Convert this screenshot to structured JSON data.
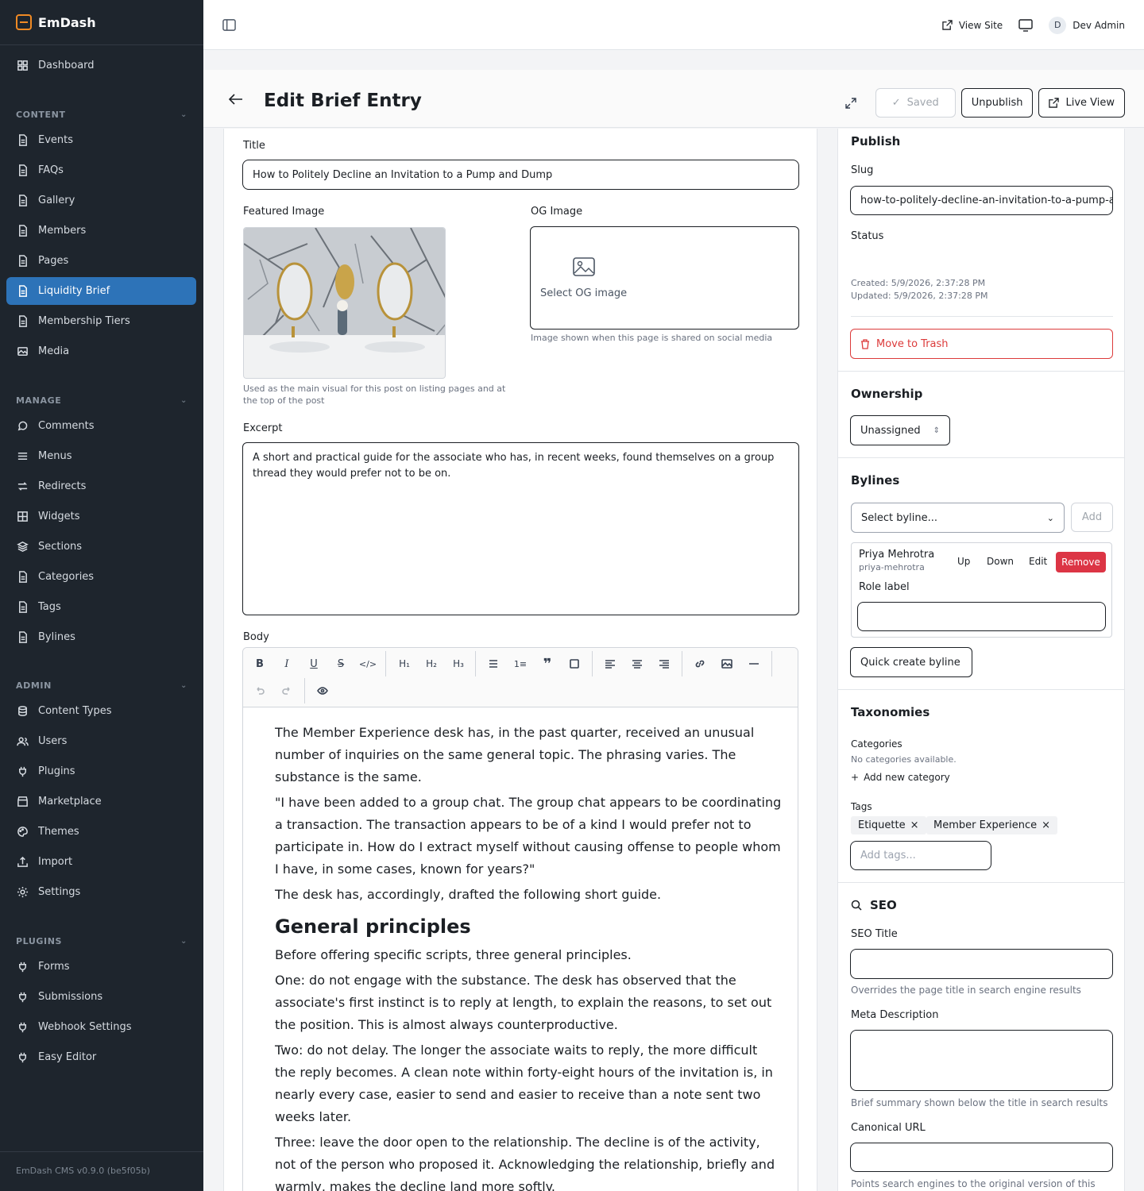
{
  "app": {
    "name": "EmDash",
    "version": "EmDash CMS v0.9.0 (be5f05b)"
  },
  "sidebar": {
    "dashboard": "Dashboard",
    "sections": {
      "content": "CONTENT",
      "manage": "MANAGE",
      "admin": "ADMIN",
      "plugins": "PLUGINS"
    },
    "content_items": [
      "Events",
      "FAQs",
      "Gallery",
      "Members",
      "Pages",
      "Liquidity Brief",
      "Membership Tiers",
      "Media"
    ],
    "manage_items": [
      "Comments",
      "Menus",
      "Redirects",
      "Widgets",
      "Sections",
      "Categories",
      "Tags",
      "Bylines"
    ],
    "admin_items": [
      "Content Types",
      "Users",
      "Plugins",
      "Marketplace",
      "Themes",
      "Import",
      "Settings"
    ],
    "plugin_items": [
      "Forms",
      "Submissions",
      "Webhook Settings",
      "Easy Editor"
    ],
    "active": "Liquidity Brief"
  },
  "topbar": {
    "view_site": "View Site",
    "user_initial": "D",
    "user_name": "Dev Admin"
  },
  "header": {
    "title": "Edit Brief Entry",
    "saved": "Saved",
    "unpublish": "Unpublish",
    "live_view": "Live View"
  },
  "editor": {
    "title_label": "Title",
    "title_value": "How to Politely Decline an Invitation to a Pump and Dump",
    "featured_label": "Featured Image",
    "featured_help": "Used as the main visual for this post on listing pages and at the top of the post",
    "og_label": "OG Image",
    "og_select": "Select OG image",
    "og_help": "Image shown when this page is shared on social media",
    "excerpt_label": "Excerpt",
    "excerpt_value": "A short and practical guide for the associate who has, in recent weeks, found themselves on a group thread they would prefer not to be on.",
    "body_label": "Body",
    "body": {
      "p1": "The Member Experience desk has, in the past quarter, received an unusual number of inquiries on the same general topic. The phrasing varies. The substance is the same.",
      "p2": "\"I have been added to a group chat. The group chat appears to be coordinating a transaction. The transaction appears to be of a kind I would prefer not to participate in. How do I extract myself without causing offense to people whom I have, in some cases, known for years?\"",
      "p3": "The desk has, accordingly, drafted the following short guide.",
      "h1": "General principles",
      "p4": "Before offering specific scripts, three general principles.",
      "p5": "One: do not engage with the substance. The desk has observed that the associate's first instinct is to reply at length, to explain the reasons, to set out the position. This is almost always counterproductive.",
      "p6": "Two: do not delay. The longer the associate waits to reply, the more difficult the reply becomes. A clean note within forty-eight hours of the invitation is, in nearly every case, easier to send and easier to receive than a note sent two weeks later.",
      "p7": "Three: leave the door open to the relationship. The decline is of the activity, not of the person who proposed it. Acknowledging the relationship, briefly and warmly, makes the decline land more softly."
    }
  },
  "publish": {
    "title": "Publish",
    "slug_label": "Slug",
    "slug_value": "how-to-politely-decline-an-invitation-to-a-pump-and-dump",
    "status_label": "Status",
    "created": "Created: 5/9/2026, 2:37:28 PM",
    "updated": "Updated: 5/9/2026, 2:37:28 PM",
    "trash": "Move to Trash"
  },
  "ownership": {
    "title": "Ownership",
    "value": "Unassigned"
  },
  "bylines": {
    "title": "Bylines",
    "select_placeholder": "Select byline...",
    "add": "Add",
    "name": "Priya Mehrotra",
    "handle": "priya-mehrotra",
    "up": "Up",
    "down": "Down",
    "edit": "Edit",
    "remove": "Remove",
    "role_label": "Role label",
    "quick_create": "Quick create byline"
  },
  "taxonomies": {
    "title": "Taxonomies",
    "categories_label": "Categories",
    "no_categories": "No categories available.",
    "add_category": "Add new category",
    "tags_label": "Tags",
    "tags": [
      "Etiquette",
      "Member Experience"
    ],
    "add_tags_placeholder": "Add tags..."
  },
  "seo": {
    "title": "SEO",
    "seo_title_label": "SEO Title",
    "seo_title_help": "Overrides the page title in search engine results",
    "meta_label": "Meta Description",
    "meta_help": "Brief summary shown below the title in search results",
    "canonical_label": "Canonical URL",
    "canonical_help": "Points search engines to the original version of this"
  }
}
